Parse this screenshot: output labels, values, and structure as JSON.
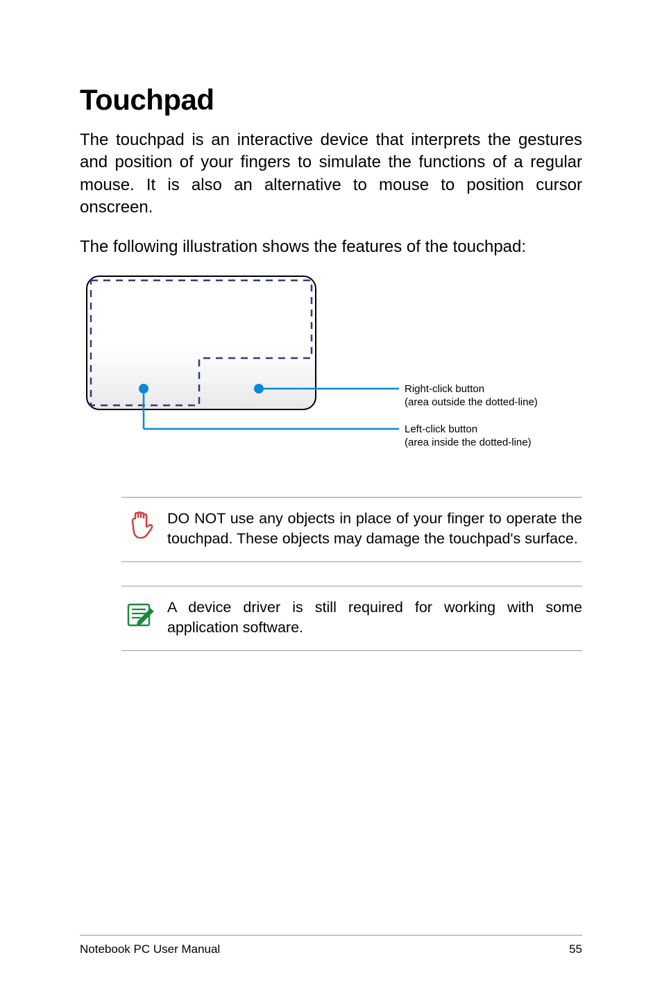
{
  "title": "Touchpad",
  "para1": "The touchpad is an interactive device that interprets the gestures and position of your fingers to simulate the functions of a regular mouse. It is also an alternative to mouse to position cursor onscreen.",
  "para2": "The following illustration shows the features of the touchpad:",
  "diagram": {
    "right_label_line1": "Right-click button",
    "right_label_line2": "(area outside the dotted-line)",
    "left_label_line1": "Left-click button",
    "left_label_line2": "(area inside the dotted-line)"
  },
  "callout1": "DO NOT use any objects in place of your finger to operate the touchpad. These objects may damage the touchpad's surface.",
  "callout2": "A device driver is still required for working with some application software.",
  "footer": {
    "left": "Notebook PC User Manual",
    "page": "55"
  }
}
